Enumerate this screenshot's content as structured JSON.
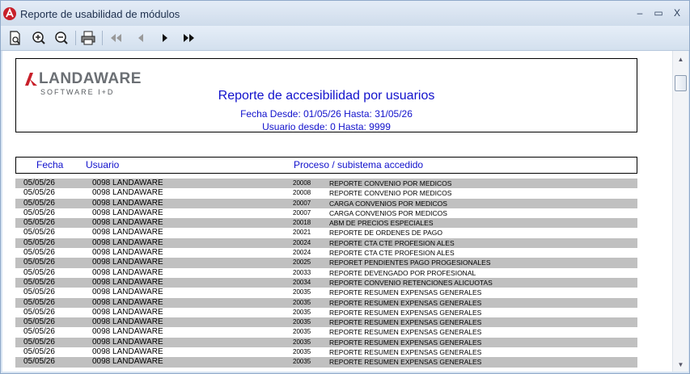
{
  "window": {
    "title": "Reporte de usabilidad de módulos",
    "controls": {
      "minimize": "–",
      "maximize": "▭",
      "close": "X"
    }
  },
  "toolbar": {
    "icons": [
      "page-preview-icon",
      "zoom-in-icon",
      "zoom-out-icon",
      "print-icon",
      "first-page-icon",
      "previous-page-icon",
      "next-page-icon",
      "last-page-icon"
    ]
  },
  "report": {
    "logo_name": "LANDAWARE",
    "logo_sub": "SOFTWARE I+D",
    "title": "Reporte de accesibilidad por usuarios",
    "date_range": "Fecha Desde: 01/05/26 Hasta: 31/05/26",
    "user_range": "Usuario desde: 0 Hasta: 9999"
  },
  "columns": {
    "fecha": "Fecha",
    "usuario": "Usuario",
    "proceso": "Proceso / subistema accedido"
  },
  "rows": [
    {
      "fecha": "05/05/26",
      "usuario": "0098  LANDAWARE",
      "codigo": "20008",
      "proceso": "REPORTE CONVENIO POR MEDICOS"
    },
    {
      "fecha": "05/05/26",
      "usuario": "0098  LANDAWARE",
      "codigo": "20008",
      "proceso": "REPORTE CONVENIO POR MEDICOS"
    },
    {
      "fecha": "05/05/26",
      "usuario": "0098  LANDAWARE",
      "codigo": "20007",
      "proceso": "CARGA CONVENIOS POR MEDICOS"
    },
    {
      "fecha": "05/05/26",
      "usuario": "0098  LANDAWARE",
      "codigo": "20007",
      "proceso": "CARGA CONVENIOS POR MEDICOS"
    },
    {
      "fecha": "05/05/26",
      "usuario": "0098  LANDAWARE",
      "codigo": "20018",
      "proceso": "ABM DE PRECIOS ESPECIALES"
    },
    {
      "fecha": "05/05/26",
      "usuario": "0098  LANDAWARE",
      "codigo": "20021",
      "proceso": "REPORTE DE ORDENES DE PAGO"
    },
    {
      "fecha": "05/05/26",
      "usuario": "0098  LANDAWARE",
      "codigo": "20024",
      "proceso": "REPORTE CTA CTE PROFESION ALES"
    },
    {
      "fecha": "05/05/26",
      "usuario": "0098  LANDAWARE",
      "codigo": "20024",
      "proceso": "REPORTE CTA CTE PROFESION ALES"
    },
    {
      "fecha": "05/05/26",
      "usuario": "0098  LANDAWARE",
      "codigo": "20025",
      "proceso": "REPORET PENDIENTES PAGO PROGESIONALES"
    },
    {
      "fecha": "05/05/26",
      "usuario": "0098  LANDAWARE",
      "codigo": "20033",
      "proceso": "REPORTE DEVENGADO POR PROFESIONAL"
    },
    {
      "fecha": "05/05/26",
      "usuario": "0098  LANDAWARE",
      "codigo": "20034",
      "proceso": "REPORTE CONVENIO RETENCIONES ALICUOTAS"
    },
    {
      "fecha": "05/05/26",
      "usuario": "0098  LANDAWARE",
      "codigo": "20035",
      "proceso": "REPORTE RESUMEN EXPENSAS GENERALES"
    },
    {
      "fecha": "05/05/26",
      "usuario": "0098  LANDAWARE",
      "codigo": "20035",
      "proceso": "REPORTE RESUMEN EXPENSAS GENERALES"
    },
    {
      "fecha": "05/05/26",
      "usuario": "0098  LANDAWARE",
      "codigo": "20035",
      "proceso": "REPORTE RESUMEN EXPENSAS GENERALES"
    },
    {
      "fecha": "05/05/26",
      "usuario": "0098  LANDAWARE",
      "codigo": "20035",
      "proceso": "REPORTE RESUMEN EXPENSAS GENERALES"
    },
    {
      "fecha": "05/05/26",
      "usuario": "0098  LANDAWARE",
      "codigo": "20035",
      "proceso": "REPORTE RESUMEN EXPENSAS GENERALES"
    },
    {
      "fecha": "05/05/26",
      "usuario": "0098  LANDAWARE",
      "codigo": "20035",
      "proceso": "REPORTE RESUMEN EXPENSAS GENERALES"
    },
    {
      "fecha": "05/05/26",
      "usuario": "0098  LANDAWARE",
      "codigo": "20035",
      "proceso": "REPORTE RESUMEN EXPENSAS GENERALES"
    },
    {
      "fecha": "05/05/26",
      "usuario": "0098  LANDAWARE",
      "codigo": "20035",
      "proceso": "REPORTE RESUMEN EXPENSAS GENERALES"
    }
  ],
  "colors": {
    "report_text": "#1111cc",
    "row_shade": "#c0c0c0",
    "logo_red": "#c8202a"
  }
}
